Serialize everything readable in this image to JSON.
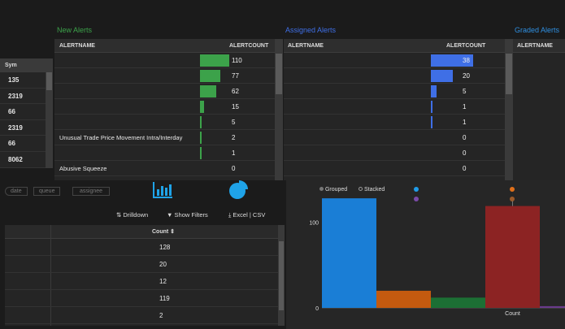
{
  "left_column": {
    "header": "Sym",
    "rows": [
      "135",
      "2319",
      "66",
      "2319",
      "66",
      "8062"
    ]
  },
  "new_alerts": {
    "title": "New Alerts",
    "title_color": "#3ca24a",
    "col_name": "ALERTNAME",
    "col_count": "ALERTCOUNT",
    "bar_color": "#3ca24a",
    "max": 110,
    "rows": [
      {
        "name": "",
        "count": 110
      },
      {
        "name": "",
        "count": 77
      },
      {
        "name": "",
        "count": 62
      },
      {
        "name": "",
        "count": 15
      },
      {
        "name": "",
        "count": 5
      },
      {
        "name": "Unusual Trade Price Movement Intra/Interday",
        "count": 2
      },
      {
        "name": "",
        "count": 1
      },
      {
        "name": "Abusive Squeeze",
        "count": 0
      }
    ]
  },
  "assigned_alerts": {
    "title": "Assigned Alerts",
    "title_color": "#3f6fe6",
    "col_name": "ALERTNAME",
    "col_count": "ALERTCOUNT",
    "bar_color": "#3f6fe6",
    "max": 38,
    "rows": [
      {
        "name": "",
        "count": 38
      },
      {
        "name": "",
        "count": 20
      },
      {
        "name": "",
        "count": 5
      },
      {
        "name": "",
        "count": 1
      },
      {
        "name": "",
        "count": 1
      },
      {
        "name": "",
        "count": 0
      },
      {
        "name": "",
        "count": 0
      },
      {
        "name": "",
        "count": 0
      }
    ]
  },
  "graded_alerts": {
    "title": "Graded Alerts",
    "title_color": "#2f8fe0",
    "col_name": "ALERTNAME"
  },
  "breadcrumb": [
    "date",
    "queue",
    "assignee"
  ],
  "toolbar": {
    "drilldown": "Drilldown",
    "show_filters": "Show Filters",
    "excel": "Excel",
    "separator": "|",
    "csv": "CSV"
  },
  "icons": {
    "bar_chart": "bar-chart-icon",
    "pie_chart": "pie-chart-icon",
    "drilldown": "drilldown-icon",
    "filter": "filter-icon",
    "download": "download-icon",
    "accent": "#1fa3e8"
  },
  "count_table": {
    "header": "Count ⇕",
    "rows": [
      "128",
      "20",
      "12",
      "119",
      "2"
    ]
  },
  "chart_controls": {
    "grouped": "Grouped",
    "stacked": "Stacked"
  },
  "chart_data": {
    "type": "bar",
    "categories": [
      "",
      "Count"
    ],
    "ylim": [
      0,
      130
    ],
    "yticks": [
      0,
      100
    ],
    "series": [
      {
        "color": "#1a7ed6",
        "values": [
          128,
          null
        ]
      },
      {
        "color": "#c45a0f",
        "values": [
          20,
          null
        ]
      },
      {
        "color": "#1c6f34",
        "values": [
          12,
          null
        ]
      },
      {
        "color": "#8c2323",
        "values": [
          null,
          119
        ]
      },
      {
        "color": "#6a3a8c",
        "values": [
          null,
          2
        ]
      }
    ],
    "legend_colors": [
      "#1f9ce8",
      "#e0701a",
      "#7a4aa8",
      "#9a5a2a"
    ]
  }
}
